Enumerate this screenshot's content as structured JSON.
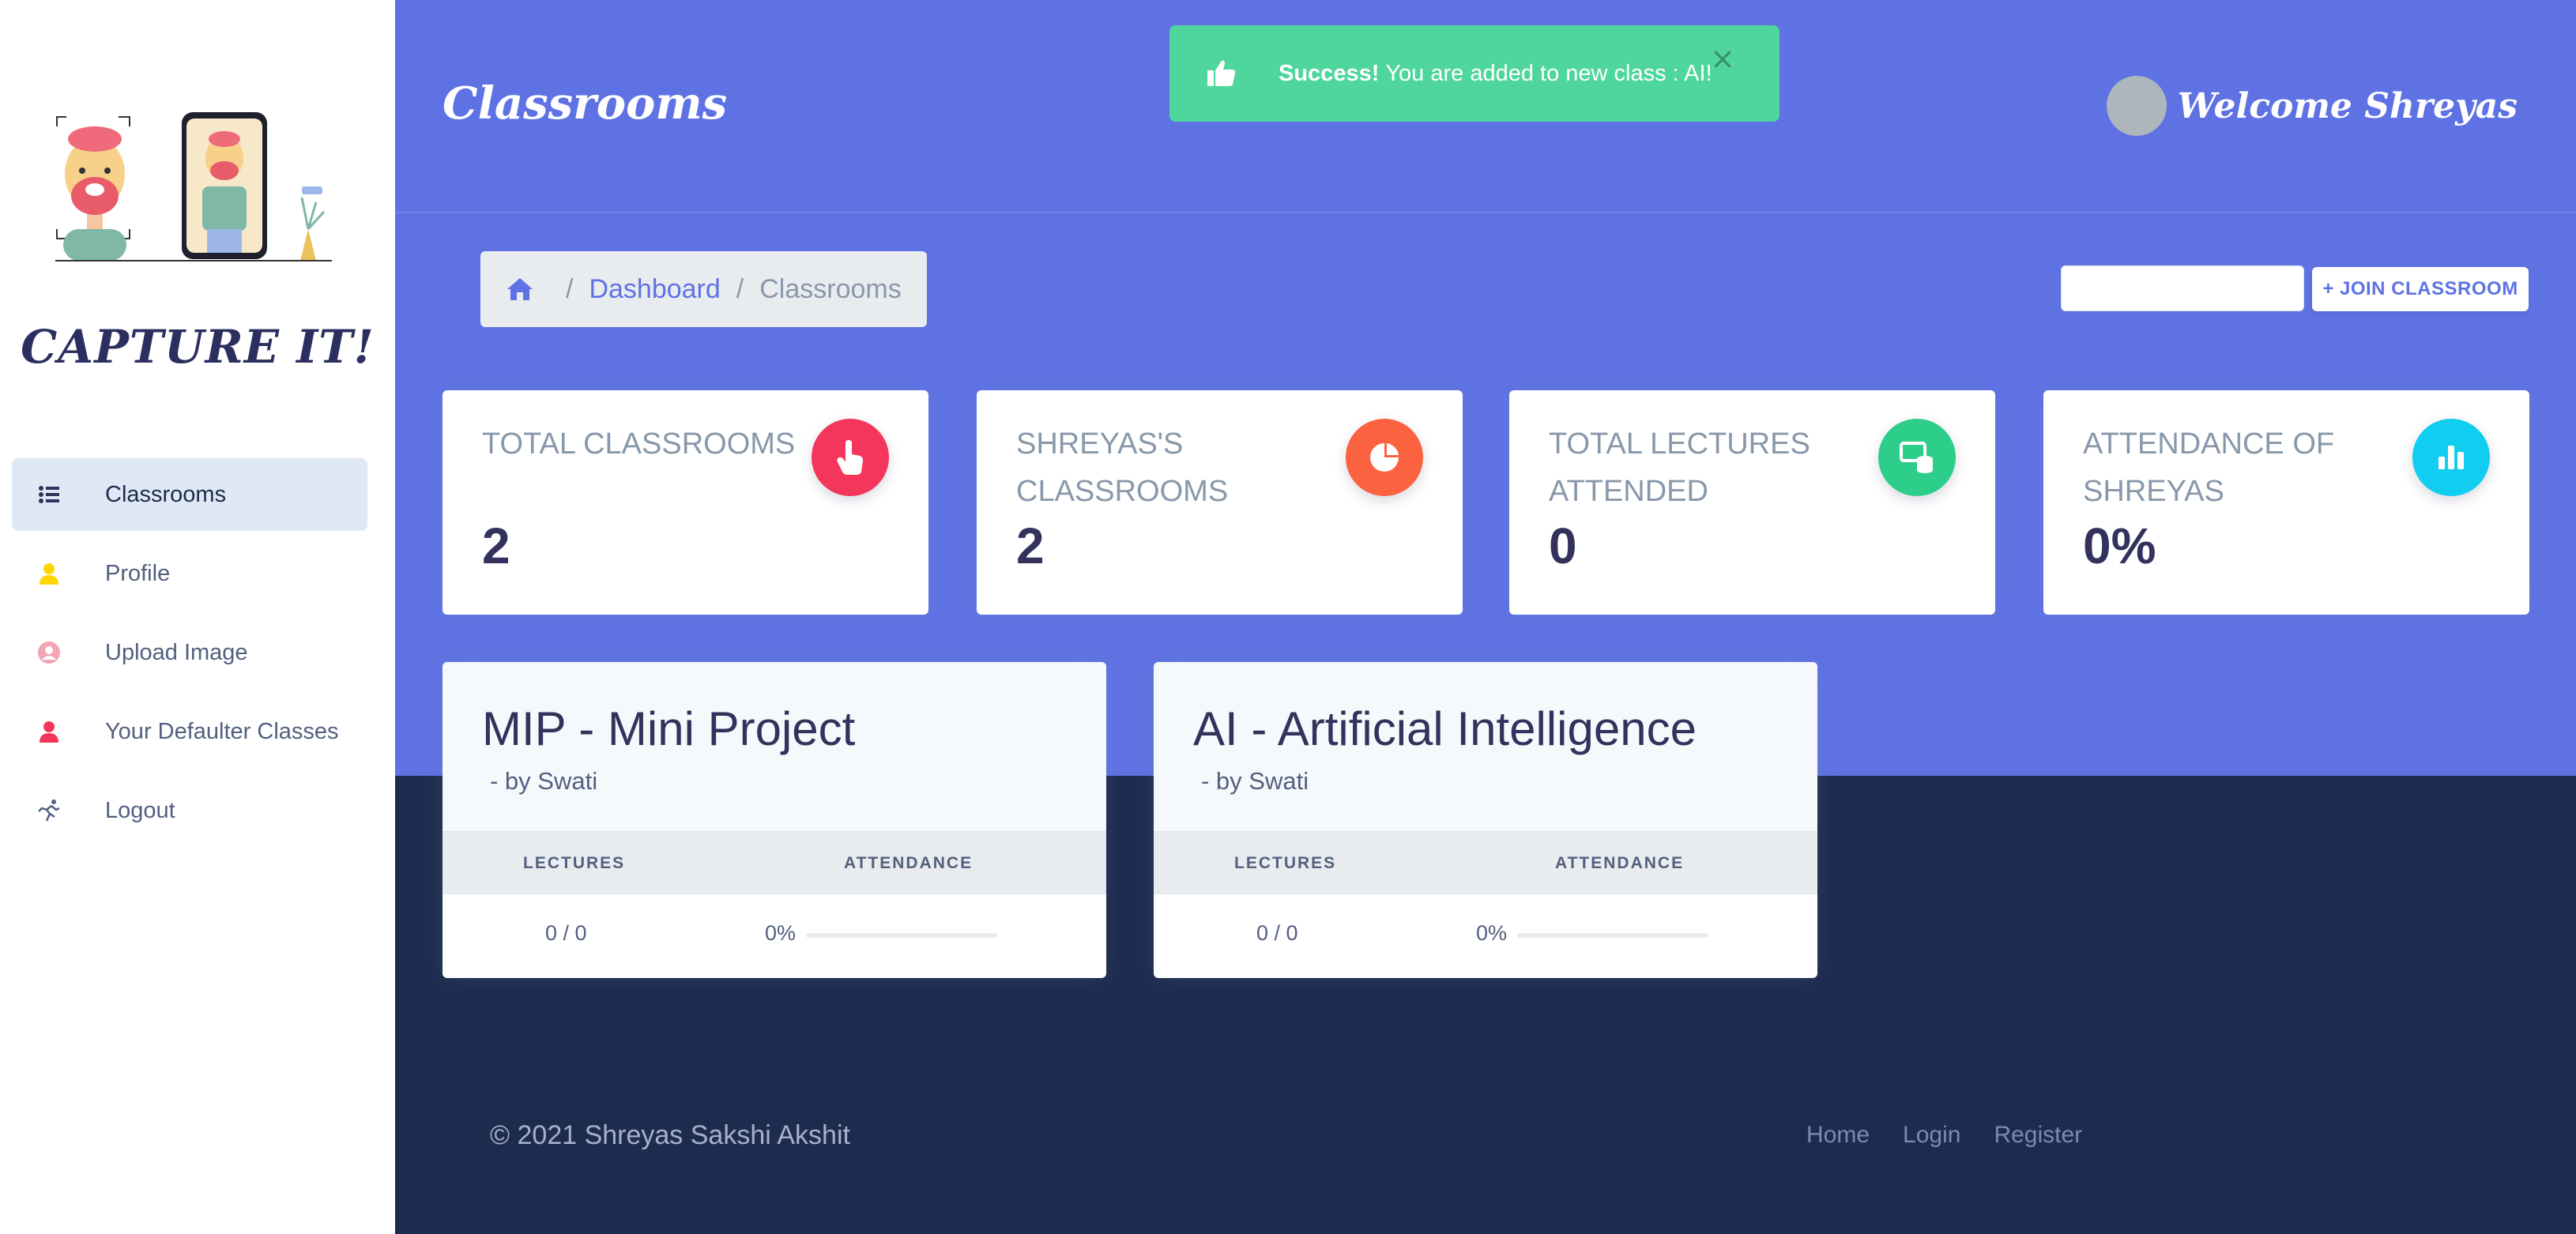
{
  "sidebar": {
    "brand": "CAPTURE IT!",
    "items": [
      {
        "label": "Classrooms",
        "icon": "list-icon",
        "active": true
      },
      {
        "label": "Profile",
        "icon": "user-icon"
      },
      {
        "label": "Upload Image",
        "icon": "user-circle-icon"
      },
      {
        "label": "Your Defaulter Classes",
        "icon": "user-icon"
      },
      {
        "label": "Logout",
        "icon": "running-icon"
      }
    ]
  },
  "header": {
    "title": "Classrooms",
    "welcome": "Welcome Shreyas"
  },
  "alert": {
    "strong": "Success!",
    "message": "You are added to new class : AI!",
    "close": "×"
  },
  "breadcrumb": {
    "items": [
      "Dashboard",
      "Classrooms"
    ],
    "separator": "/"
  },
  "join": {
    "input_value": "",
    "button_label": "+ JOIN CLASSROOM"
  },
  "stats": [
    {
      "title": "TOTAL CLASSROOMS",
      "value": "2",
      "icon": "pointer-icon",
      "color": "#f5365c"
    },
    {
      "title": "SHREYAS'S CLASSROOMS",
      "value": "2",
      "icon": "pie-chart-icon",
      "color": "#fb6340"
    },
    {
      "title": "TOTAL LECTURES ATTENDED",
      "value": "0",
      "icon": "database-icon",
      "color": "#2dce89"
    },
    {
      "title": "ATTENDANCE OF SHREYAS",
      "value": "0%",
      "icon": "bar-chart-icon",
      "color": "#11cdef"
    }
  ],
  "classes": [
    {
      "name": "MIP - Mini Project",
      "by": "- by Swati",
      "lectures_header": "LECTURES",
      "attendance_header": "ATTENDANCE",
      "lectures": "0 / 0",
      "attendance": "0%",
      "attendance_fraction": 0
    },
    {
      "name": "AI - Artificial Intelligence",
      "by": "- by Swati",
      "lectures_header": "LECTURES",
      "attendance_header": "ATTENDANCE",
      "lectures": "0 / 0",
      "attendance": "0%",
      "attendance_fraction": 0
    }
  ],
  "footer": {
    "copyright": "© 2021 Shreyas Sakshi Akshit",
    "links": [
      "Home",
      "Login",
      "Register"
    ]
  },
  "colors": {
    "primary": "#5e72e4",
    "success": "#4fd69c",
    "footer_bg": "#1d2b4f"
  }
}
